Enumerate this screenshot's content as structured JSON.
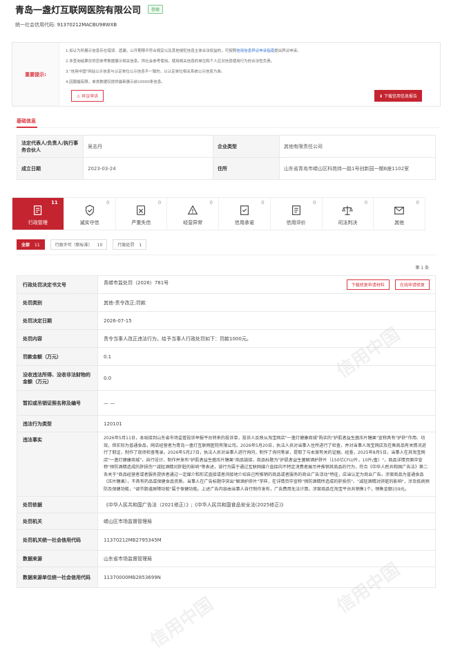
{
  "company": {
    "name": "青岛一盏灯互联网医院有限公司",
    "status": "存续",
    "credit_code_label": "统一社会信用代码:",
    "credit_code": "91370212MACBU98WXB"
  },
  "notice": {
    "label": "重要提示:",
    "lines": [
      "1.如认为所展示信息存在错误、遗漏，公开期限不符合规定以及其他侵犯信息主体合法权益的，可按照",
      "2.本查询结果仅供您参考数据展示相关信息，供社会参考使用。使用相关信息的单位和个人应对信息使用行为的合法性负责。",
      "3.\"信用中国\"网站公示信息与认定单位公示信息不一致的，以认定单位相关系统公示信息为准。",
      "4.因篇幅有限，单类数据仅提供最新展示前10000条信息。"
    ],
    "link_text": "信用信息异议申诉指南",
    "line1_tail": "提出异议申诉。",
    "objection_button": "异议申诉",
    "download_button": "下载信用信息报告"
  },
  "basic": {
    "title": "基础信息",
    "rows": [
      {
        "k1": "法定代表人/负责人/执行事务合伙人",
        "v1": "吴志丹",
        "k2": "企业类型",
        "v2": "其他有限责任公司"
      },
      {
        "k1": "成立日期",
        "v1": "2023-03-24",
        "k2": "住所",
        "v2": "山东省青岛市崂山区科苑纬一路1号创新园一期B座1102室"
      }
    ]
  },
  "tabs": [
    {
      "label": "行政管理",
      "count": "11",
      "icon": "admin-icon"
    },
    {
      "label": "诚实守信",
      "count": "0",
      "icon": "honesty-icon"
    },
    {
      "label": "严重失信",
      "count": "0",
      "icon": "dishonesty-icon"
    },
    {
      "label": "经营异常",
      "count": "0",
      "icon": "abnormal-icon"
    },
    {
      "label": "信用承诺",
      "count": "0",
      "icon": "commitment-icon"
    },
    {
      "label": "信用评价",
      "count": "0",
      "icon": "evaluation-icon"
    },
    {
      "label": "司法判决",
      "count": "0",
      "icon": "judicial-icon"
    },
    {
      "label": "其他",
      "count": "0",
      "icon": "other-icon"
    }
  ],
  "filters": [
    {
      "label": "全部",
      "count": "11"
    },
    {
      "label": "行政许可（新标准）",
      "count": "10"
    },
    {
      "label": "行政处罚",
      "count": "1"
    }
  ],
  "page": "第 1 条",
  "detail": {
    "repair_button": "下载修复申请材料",
    "online_button": "在线申请修复",
    "rows": [
      {
        "k": "行政处罚决定书文号",
        "v": "青崂市监处罚（2026）781号"
      },
      {
        "k": "处罚类别",
        "v": "其他-责令改正;罚款"
      },
      {
        "k": "处罚决定日期",
        "v": "2026-07-15"
      },
      {
        "k": "处罚内容",
        "v": "责令当事人改正违法行为，给予当事人行政处罚如下：罚款1000元。"
      },
      {
        "k": "罚款金额（万元）",
        "v": "0.1"
      },
      {
        "k": "没收违法所得、没收非法财物的金额（万元）",
        "v": "0.0"
      },
      {
        "k": "暂扣或吊销证照名称及编号",
        "v": "— —"
      },
      {
        "k": "违法行为类型",
        "v": "120101"
      },
      {
        "k": "违法事实",
        "v": "2026年5月11日，本局接到山东省市场监管投诉举报平台转来的投诉单，投诉人反映从淘宝网店\"一盏灯健康商城\"购买的\"护肌者益生菌压片糖果\"宣称具有\"护肝\"作用、功效，但实际为普通食品，网店经营者为青岛一盏灯互联网医院有限公司。2026年5月20日，执法人员对当事人住所进行了检查，并对当事人淘宝网店及在售商品有关情况进行了取证，制作了现场检查笔录。2026年5月27日，执法人员对当事人进行询问，制作了询问笔录，提取了与本案有关的证据。经查，2025年8月5日，当事人在其淘宝网店\"一盏灯健康商城\"，自行设计、制作并发布\"护肌者益生菌压片糖果\"商品链接，商品标题为\"护肌者益生菌解酒护肝片（150亿CFU/片，10片/盒）\"，商品详情页面中宣称\"预防酒精造成的肝损伤\"\"减轻酒精对肝脏的影响\"等表述，该行为属于通过互联网媒介直接向不特定消费者展示并推销其商品的行为，符合《中华人民共和国广告法》第二条关于\"商品经营者或者服务提供者通过一定媒介和形式直接或者间接地介绍自己所推销的商品或者服务的商业广告活动\"特征，应当认定为商业广告。涉案商品为普通食品（压片糖果），不具有药品或保健食品资质。当事人在广告标题中突出\"解酒护肝片\"字样，在详情页中宣称\"预防酒精所造成的肝损伤\"、\"减轻酒精对肝脏的影响\"，涉及疾病预防及保健功能，\"调节肠道屏障功能\"属于保健功能。上述广告内容由当事人自行制作发布，广告费用无法计算。涉案商品在淘宝平台共销售1个，销售金额159元。"
      },
      {
        "k": "处罚依据",
        "v": "《中华人民共和国广告法（2021修正）》;《中华人民共和国食品安全法(2025修正)》"
      },
      {
        "k": "处罚机关",
        "v": "崂山区市场监督管理局"
      },
      {
        "k": "处罚机关统一社会信用代码",
        "v": "11370212MB2795345M"
      },
      {
        "k": "数据来源",
        "v": "山东省市场监督管理局"
      },
      {
        "k": "数据来源单位统一社会信用代码",
        "v": "11370000MB2853699N"
      }
    ]
  },
  "watermark": "信用中国",
  "colors": {
    "accent": "#c4242f",
    "status_green": "#3a9a4e",
    "link": "#2f6fd0"
  }
}
